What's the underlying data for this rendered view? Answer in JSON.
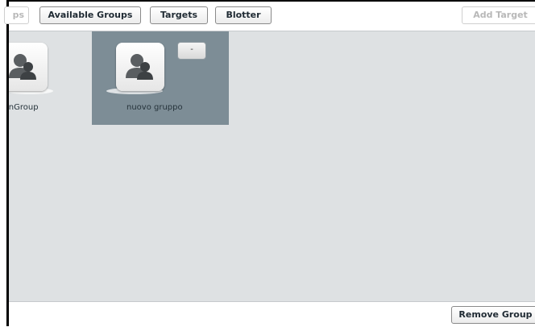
{
  "toolbar": {
    "cut_button_label": "ps",
    "available_groups_label": "Available Groups",
    "targets_label": "Targets",
    "blotter_label": "Blotter",
    "add_target_label": "Add Target"
  },
  "groups": [
    {
      "label": "inGroup",
      "icon": "group-icon",
      "selected": false
    },
    {
      "label": "nuovo gruppo",
      "icon": "group-icon",
      "selected": true,
      "remove_label": "-"
    }
  ],
  "footer": {
    "remove_group_label": "Remove Group"
  },
  "colors": {
    "content_bg": "#dee1e3",
    "selected_tile_bg": "#7d8d96",
    "button_text": "#1f2a33",
    "disabled_text": "#b8b8b8"
  }
}
